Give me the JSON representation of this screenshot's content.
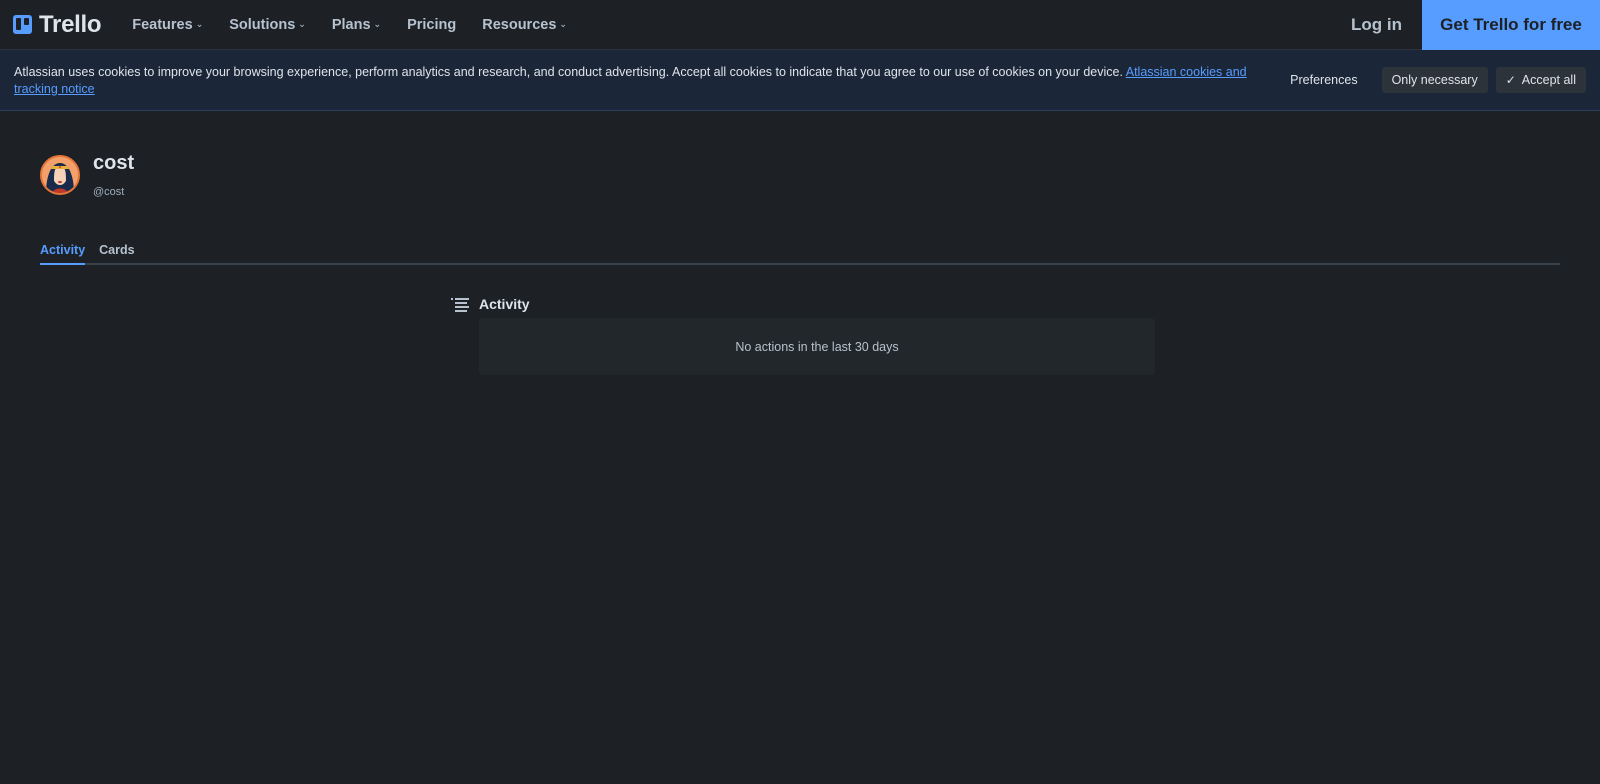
{
  "header": {
    "logo_text": "Trello",
    "nav": [
      {
        "label": "Features",
        "has_dropdown": true
      },
      {
        "label": "Solutions",
        "has_dropdown": true
      },
      {
        "label": "Plans",
        "has_dropdown": true
      },
      {
        "label": "Pricing",
        "has_dropdown": false
      },
      {
        "label": "Resources",
        "has_dropdown": true
      }
    ],
    "login_label": "Log in",
    "cta_label": "Get Trello for free"
  },
  "cookie_banner": {
    "text": "Atlassian uses cookies to improve your browsing experience, perform analytics and research, and conduct advertising. Accept all cookies to indicate that you agree to our use of cookies on your device.",
    "link_text": "Atlassian cookies and tracking notice",
    "preferences_label": "Preferences",
    "only_necessary_label": "Only necessary",
    "accept_all_label": "Accept all"
  },
  "profile": {
    "display_name": "cost",
    "username": "@cost"
  },
  "tabs": [
    {
      "label": "Activity",
      "active": true
    },
    {
      "label": "Cards",
      "active": false
    }
  ],
  "activity": {
    "title": "Activity",
    "empty_message": "No actions in the last 30 days"
  },
  "colors": {
    "background": "#1d2125",
    "accent": "#579dff",
    "banner_bg": "#1b2638"
  }
}
